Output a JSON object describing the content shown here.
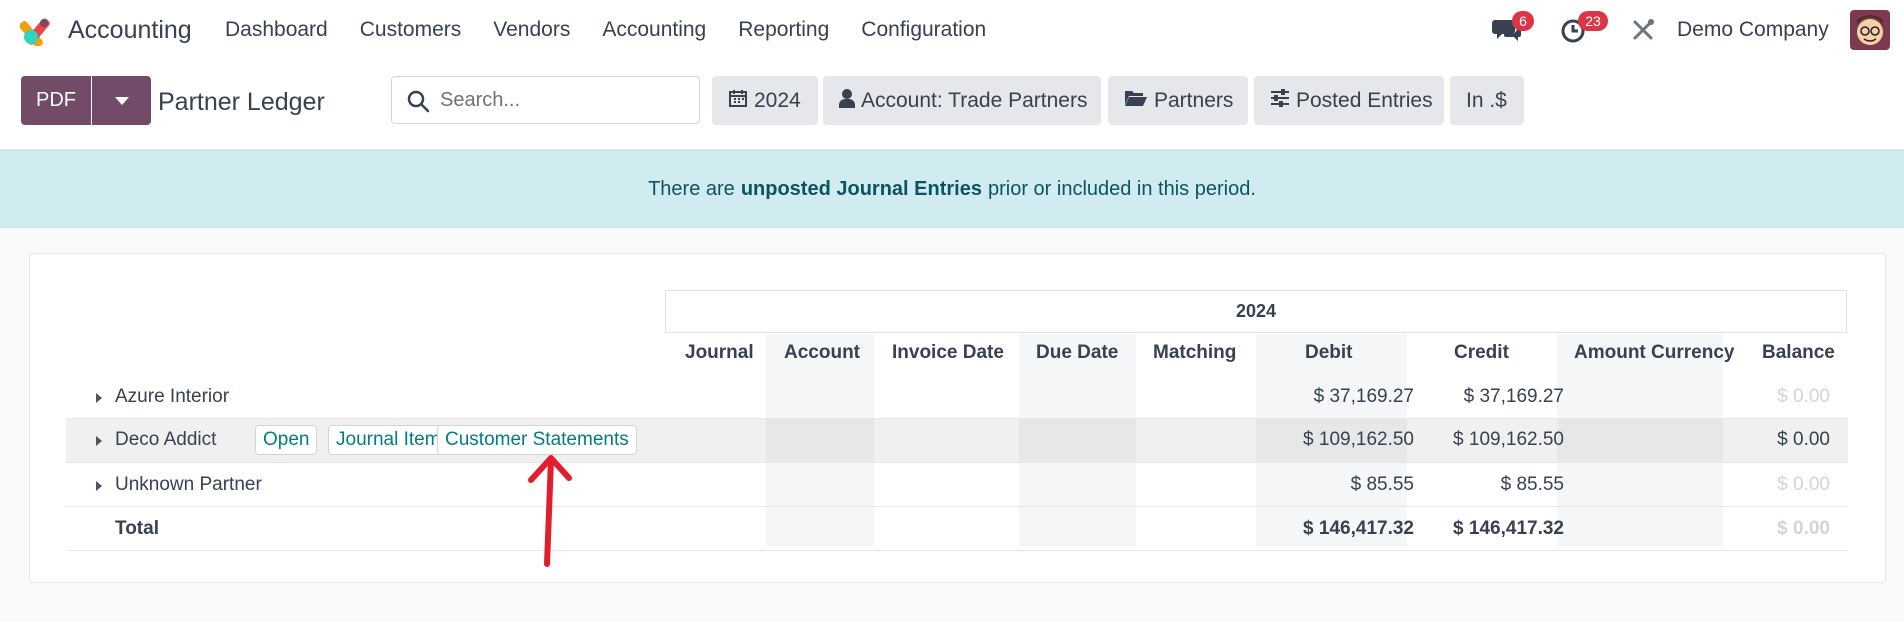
{
  "navbar": {
    "app_name": "Accounting",
    "menu": [
      "Dashboard",
      "Customers",
      "Vendors",
      "Accounting",
      "Reporting",
      "Configuration"
    ],
    "messages_badge": "6",
    "activities_badge": "23",
    "company": "Demo Company"
  },
  "control_panel": {
    "pdf_label": "PDF",
    "title": "Partner Ledger",
    "search_placeholder": "Search...",
    "filters": {
      "date": "2024",
      "account": "Account: Trade Partners",
      "partners": "Partners",
      "posted": "Posted Entries",
      "currency": "In .$"
    }
  },
  "alert": {
    "prefix": "There are",
    "emphasis": "unposted Journal Entries",
    "suffix": "prior or included in this period."
  },
  "report": {
    "period": "2024",
    "columns": [
      "Journal",
      "Account",
      "Invoice Date",
      "Due Date",
      "Matching",
      "Debit",
      "Credit",
      "Amount Currency",
      "Balance"
    ],
    "rows": [
      {
        "name": "Azure Interior",
        "debit": "$ 37,169.27",
        "credit": "$ 37,169.27",
        "balance": "$ 0.00"
      },
      {
        "name": "Deco Addict",
        "debit": "$ 109,162.50",
        "credit": "$ 109,162.50",
        "balance": "$ 0.00",
        "actions": [
          "Open",
          "Journal Items",
          "Customer Statements"
        ]
      },
      {
        "name": "Unknown Partner",
        "debit": "$ 85.55",
        "credit": "$ 85.55",
        "balance": "$ 0.00"
      }
    ],
    "total": {
      "name": "Total",
      "debit": "$ 146,417.32",
      "credit": "$ 146,417.32",
      "balance": "$ 0.00"
    }
  },
  "colors": {
    "brand": "#714b67",
    "link": "#017e84",
    "alert_bg": "#d1ecf1",
    "badge": "#dc3545",
    "annotation_arrow": "#e11d2e"
  },
  "icons": [
    "odoo-logo-icon",
    "chat-icon",
    "clock-icon",
    "tools-icon",
    "caret-down-icon",
    "search-icon",
    "calendar-icon",
    "user-icon",
    "folder-open-icon",
    "sliders-icon",
    "caret-right-icon"
  ]
}
